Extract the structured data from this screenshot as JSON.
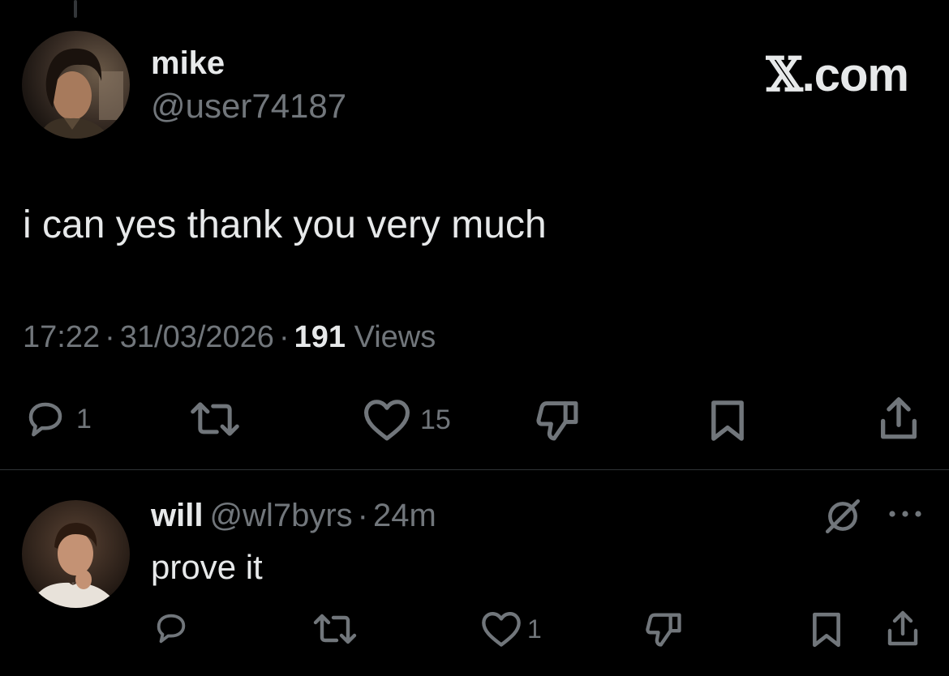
{
  "main_tweet": {
    "display_name": "mike",
    "handle": "@user74187",
    "text": "i can yes thank you very much",
    "time": "17:22",
    "date": "31/03/2026",
    "separator": "·",
    "views_count": "191",
    "views_label": "Views",
    "actions": {
      "reply_count": "1",
      "like_count": "15"
    }
  },
  "brand": {
    "x_glyph": "𝕏",
    "domain_suffix": ".com"
  },
  "reply": {
    "display_name": "will",
    "handle": "@wl7byrs",
    "separator": "·",
    "time": "24m",
    "text": "prove it",
    "actions": {
      "like_count": "1"
    }
  },
  "icons": {
    "reply": "speech-bubble-icon",
    "repost": "repost-arrows-icon",
    "like": "heart-icon",
    "dislike": "thumbs-down-icon",
    "bookmark": "bookmark-icon",
    "share": "share-upload-icon",
    "grok": "grok-slash-circle-icon",
    "more": "more-dots-icon"
  },
  "colors": {
    "background": "#000000",
    "primary_text": "#e7e9ea",
    "secondary_text": "#71767b",
    "divider": "#2f3336"
  }
}
